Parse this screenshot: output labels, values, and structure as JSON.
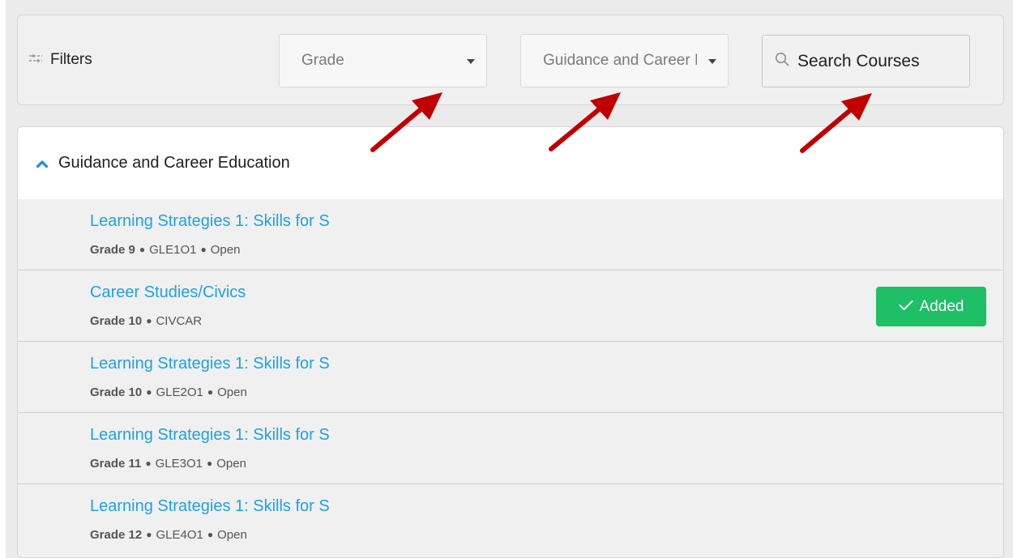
{
  "filters": {
    "label": "Filters",
    "label_icon": "sliders-icon",
    "grade_select": {
      "value": "Grade"
    },
    "subject_select": {
      "value": "Guidance and Career Education"
    },
    "search_button": {
      "label": "Search Courses",
      "icon": "search-icon"
    }
  },
  "section": {
    "title": "Guidance and Career Education",
    "expanded": true,
    "toggle_icon": "chevron-up-icon",
    "courses": [
      {
        "title": "Learning Strategies 1: Skills for S",
        "grade": "Grade 9",
        "code": "GLE1O1",
        "type": "Open",
        "added": false
      },
      {
        "title": "Career Studies/Civics",
        "grade": "Grade 10",
        "code": "CIVCAR",
        "type": "",
        "added": true
      },
      {
        "title": "Learning Strategies 1: Skills for S",
        "grade": "Grade 10",
        "code": "GLE2O1",
        "type": "Open",
        "added": false
      },
      {
        "title": "Learning Strategies 1: Skills for S",
        "grade": "Grade 11",
        "code": "GLE3O1",
        "type": "Open",
        "added": false
      },
      {
        "title": "Learning Strategies 1: Skills for S",
        "grade": "Grade 12",
        "code": "GLE4O1",
        "type": "Open",
        "added": false
      }
    ],
    "added_button_label": "Added"
  },
  "colors": {
    "link": "#1ea1e6",
    "added_green": "#1ebf65",
    "annotation_arrow": "#c00000",
    "chevron": "#1a8ddb"
  }
}
